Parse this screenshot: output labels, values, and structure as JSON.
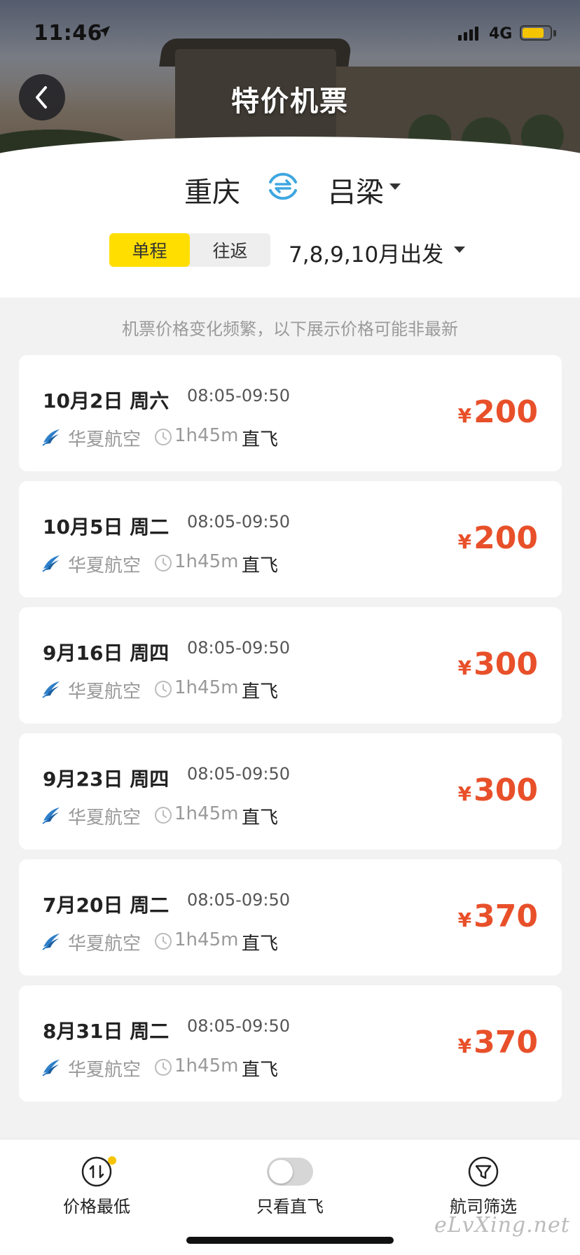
{
  "status": {
    "time": "11:46",
    "network": "4G",
    "battery_level": 0.8
  },
  "header": {
    "title": "特价机票",
    "back_icon": "chevron-left-icon"
  },
  "route": {
    "from": "重庆",
    "to": "吕梁",
    "swap_icon": "swap-icon"
  },
  "trip_type": {
    "options": [
      "单程",
      "往返"
    ],
    "selected": "单程"
  },
  "depart_filter": {
    "label": "7,8,9,10月出发"
  },
  "notice": "机票价格变化频繁，以下展示价格可能非最新",
  "flights": [
    {
      "date": "10月2日 周六",
      "time": "08:05-09:50",
      "airline": "华夏航空",
      "duration": "1h45m",
      "type": "直飞",
      "currency": "¥",
      "price": "200"
    },
    {
      "date": "10月5日 周二",
      "time": "08:05-09:50",
      "airline": "华夏航空",
      "duration": "1h45m",
      "type": "直飞",
      "currency": "¥",
      "price": "200"
    },
    {
      "date": "9月16日 周四",
      "time": "08:05-09:50",
      "airline": "华夏航空",
      "duration": "1h45m",
      "type": "直飞",
      "currency": "¥",
      "price": "300"
    },
    {
      "date": "9月23日 周四",
      "time": "08:05-09:50",
      "airline": "华夏航空",
      "duration": "1h45m",
      "type": "直飞",
      "currency": "¥",
      "price": "300"
    },
    {
      "date": "7月20日 周二",
      "time": "08:05-09:50",
      "airline": "华夏航空",
      "duration": "1h45m",
      "type": "直飞",
      "currency": "¥",
      "price": "370"
    },
    {
      "date": "8月31日 周二",
      "time": "08:05-09:50",
      "airline": "华夏航空",
      "duration": "1h45m",
      "type": "直飞",
      "currency": "¥",
      "price": "370"
    }
  ],
  "bottom_bar": {
    "price_lowest": "价格最低",
    "direct_only": "只看直飞",
    "airline_filter": "航司筛选",
    "direct_only_on": false
  },
  "watermark": "eLvXing.net",
  "colors": {
    "accent": "#ffde00",
    "price": "#e8502a",
    "swap": "#3ea7e0"
  }
}
